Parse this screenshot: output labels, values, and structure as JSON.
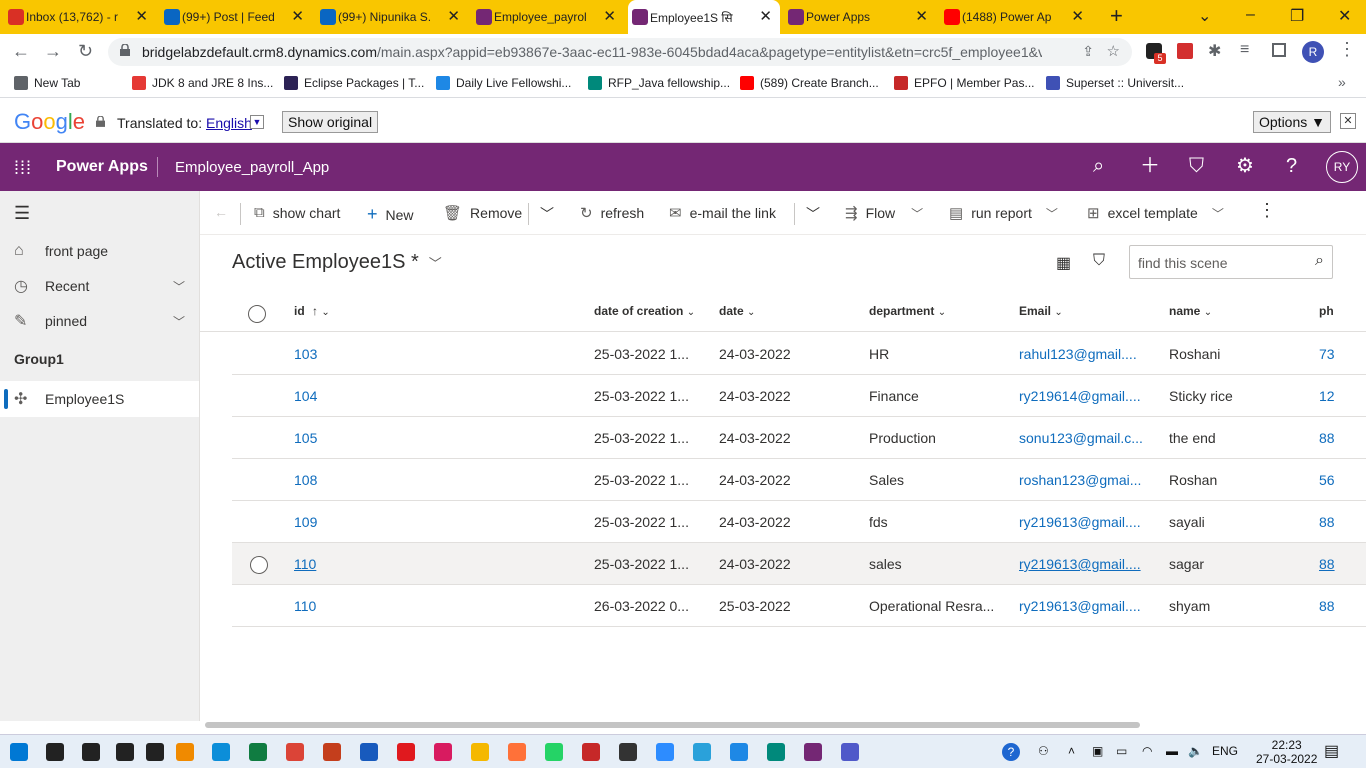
{
  "browser": {
    "tabs": [
      {
        "label": "Inbox (13,762) - r",
        "color": "#d93025",
        "icon": "gmail-icon"
      },
      {
        "label": "(99+) Post | Feed",
        "color": "#0a66c2",
        "icon": "linkedin-icon"
      },
      {
        "label": "(99+) Nipunika S.",
        "color": "#0a66c2",
        "icon": "linkedin-icon"
      },
      {
        "label": "Employee_payrol",
        "color": "#742774",
        "icon": "powerapps-icon"
      },
      {
        "label": "Employee1S सि",
        "color": "#742774",
        "icon": "powerapps-icon"
      },
      {
        "label": "Power Apps",
        "color": "#742774",
        "icon": "powerapps-icon"
      },
      {
        "label": "(1488) Power Ap",
        "color": "#ff0000",
        "icon": "youtube-icon"
      }
    ],
    "url_host": "bridgelabzdefault.crm8.dynamics.com",
    "url_path": "/main.aspx?appid=eb93867e-3aac-ec11-983e-6045bdad4aca&pagetype=entitylist&etn=crc5f_employee1&vi...",
    "bookmarks": [
      {
        "label": "New Tab",
        "color": "#5f6368"
      },
      {
        "label": "JDK 8 and JRE 8 Ins...",
        "color": "#e53935"
      },
      {
        "label": "Eclipse Packages | T...",
        "color": "#2c2255"
      },
      {
        "label": "Daily Live Fellowshi...",
        "color": "#1e88e5"
      },
      {
        "label": "RFP_Java fellowship...",
        "color": "#00897b"
      },
      {
        "label": "(589) Create Branch...",
        "color": "#ff0000"
      },
      {
        "label": "EPFO | Member Pas...",
        "color": "#c62828"
      },
      {
        "label": "Superset :: Universit...",
        "color": "#3f51b5"
      }
    ],
    "profile_initial": "R",
    "ext_badge": "5"
  },
  "translate": {
    "label": "Translated to:",
    "language": "English",
    "show_original": "Show original",
    "options": "Options ▼",
    "close": "✕",
    "google": "Google"
  },
  "app": {
    "brand": "Power Apps",
    "name": "Employee_payroll_App",
    "avatar": "RY",
    "accent": "#742774"
  },
  "sidebar": {
    "items": [
      {
        "label": "front page",
        "icon": "home-icon"
      },
      {
        "label": "Recent",
        "icon": "clock-icon"
      },
      {
        "label": "pinned",
        "icon": "pin-icon"
      }
    ],
    "group": "Group1",
    "entity": "Employee1S"
  },
  "commands": {
    "show_chart": "show chart",
    "new": "New",
    "remove": "Remove",
    "refresh": "refresh",
    "email_link": "e-mail the link",
    "flow": "Flow",
    "run_report": "run report",
    "excel_template": "excel template"
  },
  "view": {
    "title": "Active Employee1S *",
    "search_placeholder": "find this scene"
  },
  "columns": {
    "id": "id",
    "created": "date of creation",
    "date": "date",
    "department": "department",
    "email": "Email",
    "name": "name",
    "phone": "ph"
  },
  "rows": [
    {
      "id": "103",
      "created": "25-03-2022 1...",
      "date": "24-03-2022",
      "department": "HR",
      "email": "rahul123@gmail....",
      "name": "Roshani",
      "phone": "73"
    },
    {
      "id": "104",
      "created": "25-03-2022 1...",
      "date": "24-03-2022",
      "department": "Finance",
      "email": "ry219614@gmail....",
      "name": "Sticky rice",
      "phone": "12"
    },
    {
      "id": "105",
      "created": "25-03-2022 1...",
      "date": "24-03-2022",
      "department": "Production",
      "email": "sonu123@gmail.c...",
      "name": "the end",
      "phone": "88"
    },
    {
      "id": "108",
      "created": "25-03-2022 1...",
      "date": "24-03-2022",
      "department": "Sales",
      "email": "roshan123@gmai...",
      "name": "Roshan",
      "phone": "56"
    },
    {
      "id": "109",
      "created": "25-03-2022 1...",
      "date": "24-03-2022",
      "department": "fds",
      "email": "ry219613@gmail....",
      "name": "sayali",
      "phone": "88"
    },
    {
      "id": "110",
      "created": "25-03-2022 1...",
      "date": "24-03-2022",
      "department": "sales",
      "email": "ry219613@gmail....",
      "name": "sagar",
      "phone": "88"
    },
    {
      "id": "110",
      "created": "26-03-2022 0...",
      "date": "25-03-2022",
      "department": "Operational Resra...",
      "email": "ry219613@gmail....",
      "name": "shyam",
      "phone": "88"
    }
  ],
  "taskbar": {
    "lang": "ENG",
    "time": "22:23",
    "date": "27-03-2022"
  }
}
